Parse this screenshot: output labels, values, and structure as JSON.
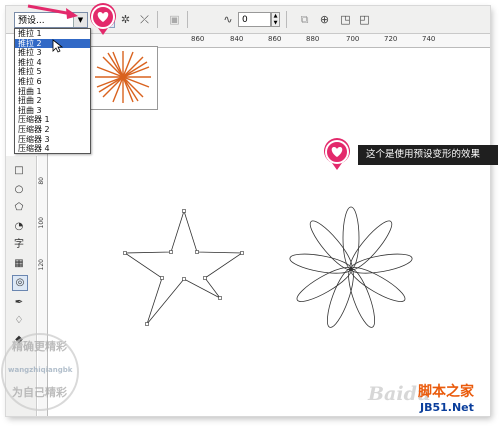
{
  "toolbar": {
    "preset_value": "预设...",
    "spin_value": "0",
    "icons": [
      "preset-dropdown",
      "pushpull-icon",
      "zipper-icon",
      "twister-icon",
      "copy-properties-icon",
      "amplitude-icon"
    ]
  },
  "dropdown": {
    "items": [
      "推拉 1",
      "推拉 2",
      "推拉 3",
      "推拉 4",
      "推拉 5",
      "推拉 6",
      "扭曲 1",
      "扭曲 2",
      "扭曲 3",
      "压缩器 1",
      "压缩器 2",
      "压缩器 3",
      "压缩器 4"
    ],
    "selected_index": 1
  },
  "ruler": {
    "h_ticks": [
      "860",
      "820",
      "840",
      "860",
      "880",
      "700",
      "720",
      "740"
    ],
    "v_ticks": [
      "80",
      "100",
      "120"
    ]
  },
  "callout": {
    "text": "这个是使用预设变形的效果"
  },
  "watermarks": {
    "left_line1": "精确更精彩",
    "left_line2": "wangzhiqiangbk",
    "left_line3": "为自己精彩",
    "brand_cn": "脚本之家",
    "brand_url": "JB51.Net",
    "baidu": "Baidu"
  },
  "colors": {
    "accent_pin": "#e3296b",
    "selection": "#3169c6",
    "thumb_flower": "#d9621e"
  }
}
